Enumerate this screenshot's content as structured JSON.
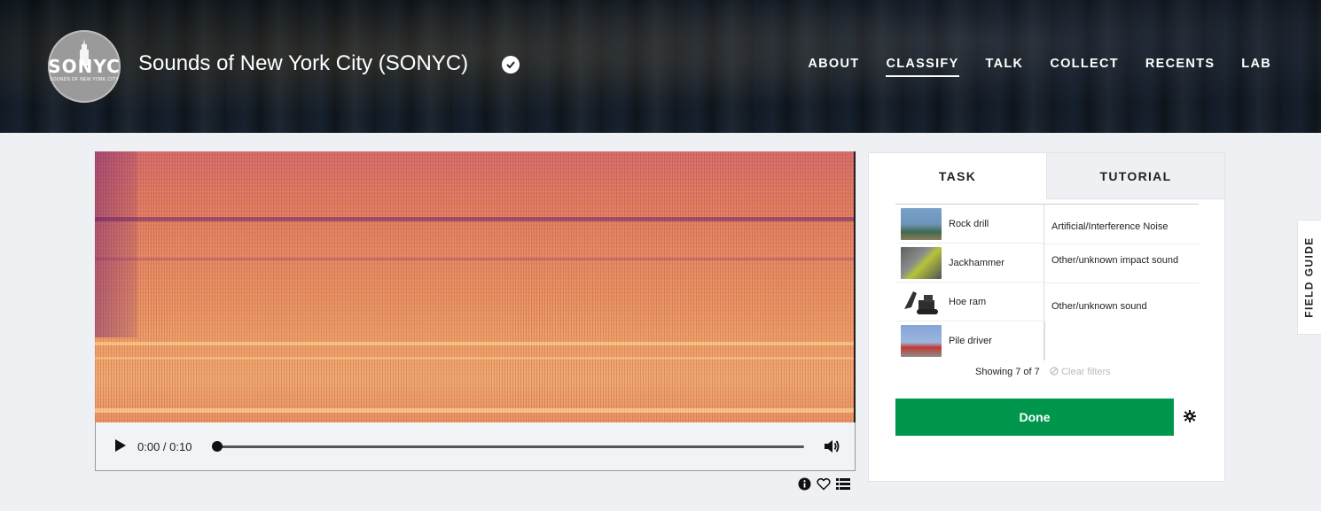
{
  "header": {
    "avatar_text": "SONYC",
    "avatar_sub": "SOUNDS OF NEW YORK CITY",
    "title": "Sounds of New York City (SONYC)",
    "nav": [
      {
        "label": "ABOUT"
      },
      {
        "label": "CLASSIFY",
        "active": true
      },
      {
        "label": "TALK"
      },
      {
        "label": "COLLECT"
      },
      {
        "label": "RECENTS"
      },
      {
        "label": "LAB"
      }
    ]
  },
  "audio": {
    "time": "0:00 / 0:10",
    "progress": 0
  },
  "panel": {
    "tabs": [
      "TASK",
      "TUTORIAL"
    ],
    "choices": [
      {
        "label": "Rock drill",
        "thumb_color": "#5a7fa3"
      },
      {
        "label": "Jackhammer",
        "thumb_color": "#6a6f6d"
      },
      {
        "label": "Hoe ram",
        "thumb_color": "#3d3f3f"
      },
      {
        "label": "Pile driver",
        "thumb_color": "#7b8fb0"
      }
    ],
    "categories": [
      "Artificial/Interference Noise",
      "Other/unknown impact sound",
      "Other/unknown sound"
    ],
    "showing": "Showing 7 of 7",
    "clear_filters": "Clear filters",
    "done_label": "Done"
  },
  "field_guide_label": "FIELD GUIDE",
  "colors": {
    "done_green": "#00974c",
    "header_bg": "#1c2633",
    "page_bg": "#eef0f3"
  }
}
